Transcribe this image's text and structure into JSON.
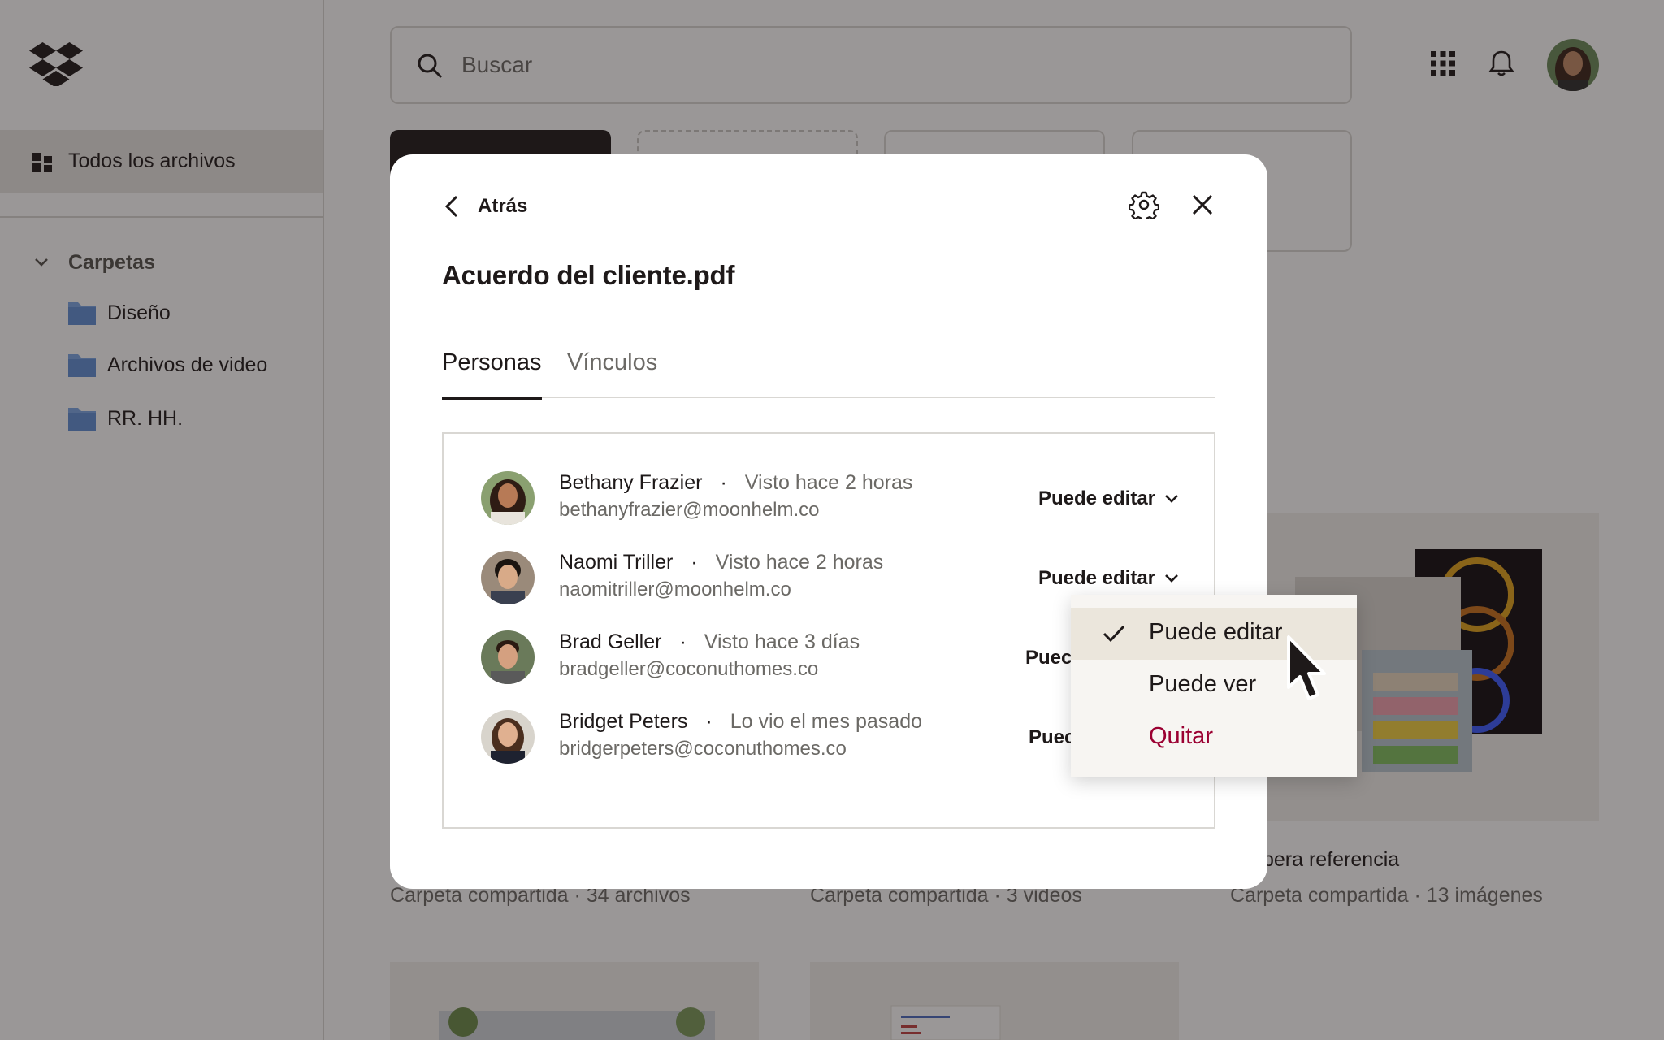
{
  "search": {
    "placeholder": "Buscar"
  },
  "sidebar": {
    "active_item": "Todos los archivos",
    "folders_heading": "Carpetas",
    "folders": [
      "Diseño",
      "Archivos de video",
      "RR. HH."
    ]
  },
  "background_cards": [
    {
      "title": "",
      "subtitle": "Carpeta compartida · 34 archivos"
    },
    {
      "title": "",
      "subtitle": "Carpeta compartida · 3 videos"
    },
    {
      "title": "pera referencia",
      "subtitle": "Carpeta compartida · 13 imágenes"
    }
  ],
  "modal": {
    "back_label": "Atrás",
    "file_title": "Acuerdo del cliente.pdf",
    "tabs": [
      "Personas",
      "Vínculos"
    ],
    "people": [
      {
        "name": "Bethany Frazier",
        "seen": "Visto hace 2 horas",
        "email": "bethanyfrazier@moonhelm.co",
        "permission": "Puede editar"
      },
      {
        "name": "Naomi Triller",
        "seen": "Visto hace 2 horas",
        "email": "naomitriller@moonhelm.co",
        "permission": "Puede editar"
      },
      {
        "name": "Brad Geller",
        "seen": "Visto hace 3 días",
        "email": "bradgeller@coconuthomes.co",
        "permission": "Puec"
      },
      {
        "name": "Bridget Peters",
        "seen": "Lo vio el mes pasado",
        "email": "bridgerpeters@coconuthomes.co",
        "permission": "Puec"
      }
    ]
  },
  "dropdown": {
    "options": [
      "Puede editar",
      "Puede ver",
      "Quitar"
    ],
    "selected": "Puede editar",
    "danger_color": "#9b0032"
  },
  "separator": "·"
}
